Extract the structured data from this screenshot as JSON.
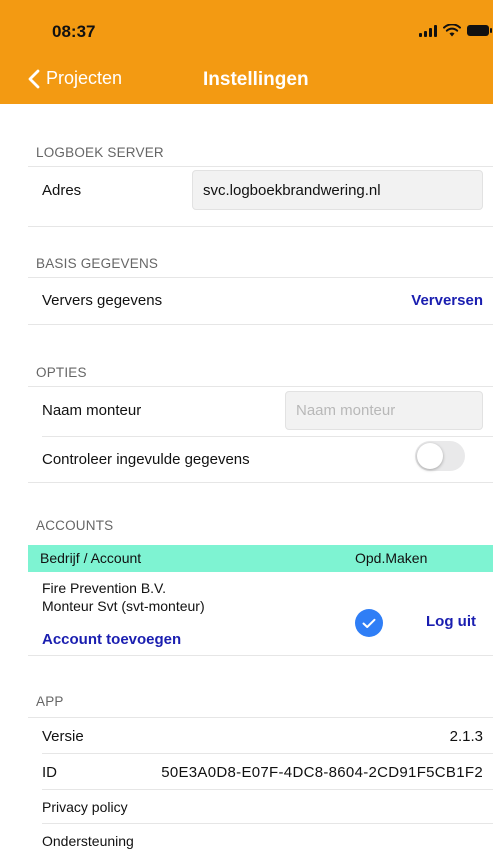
{
  "status_bar": {
    "time": "08:37"
  },
  "nav": {
    "back_label": "Projecten",
    "title": "Instellingen"
  },
  "server": {
    "header": "LOGBOEK SERVER",
    "address_label": "Adres",
    "address_value": "svc.logboekbrandwering.nl"
  },
  "basis": {
    "header": "BASIS GEGEVENS",
    "refresh_label": "Ververs gegevens",
    "refresh_action": "Verversen"
  },
  "options": {
    "header": "OPTIES",
    "name_label": "Naam monteur",
    "name_placeholder": "Naam monteur",
    "check_label": "Controleer ingevulde gegevens",
    "check_enabled": false
  },
  "accounts": {
    "header": "ACCOUNTS",
    "col_company": "Bedrijf / Account",
    "col_make": "Opd.Maken",
    "items": [
      {
        "company": "Fire Prevention B.V.",
        "account": "Monteur Svt  (svt-monteur)",
        "can_make": true,
        "logout_label": "Log uit"
      }
    ],
    "add_label": "Account toevoegen"
  },
  "app": {
    "header": "APP",
    "version_label": "Versie",
    "version_value": "2.1.3",
    "id_label": "ID",
    "id_value": "50E3A0D8-E07F-4DC8-8604-2CD91F5CB1F2",
    "privacy_label": "Privacy policy",
    "support_label": "Ondersteuning"
  },
  "colors": {
    "header_bg": "#f39a12",
    "accent_link": "#1a1eb0",
    "accounts_header_bg": "#7ef3d2",
    "check_blue": "#2f7ef6"
  },
  "icons": {
    "back": "chevron-left-icon",
    "signal": "signal-icon",
    "wifi": "wifi-icon",
    "battery": "battery-icon",
    "checkmark": "checkmark-circle-icon"
  }
}
